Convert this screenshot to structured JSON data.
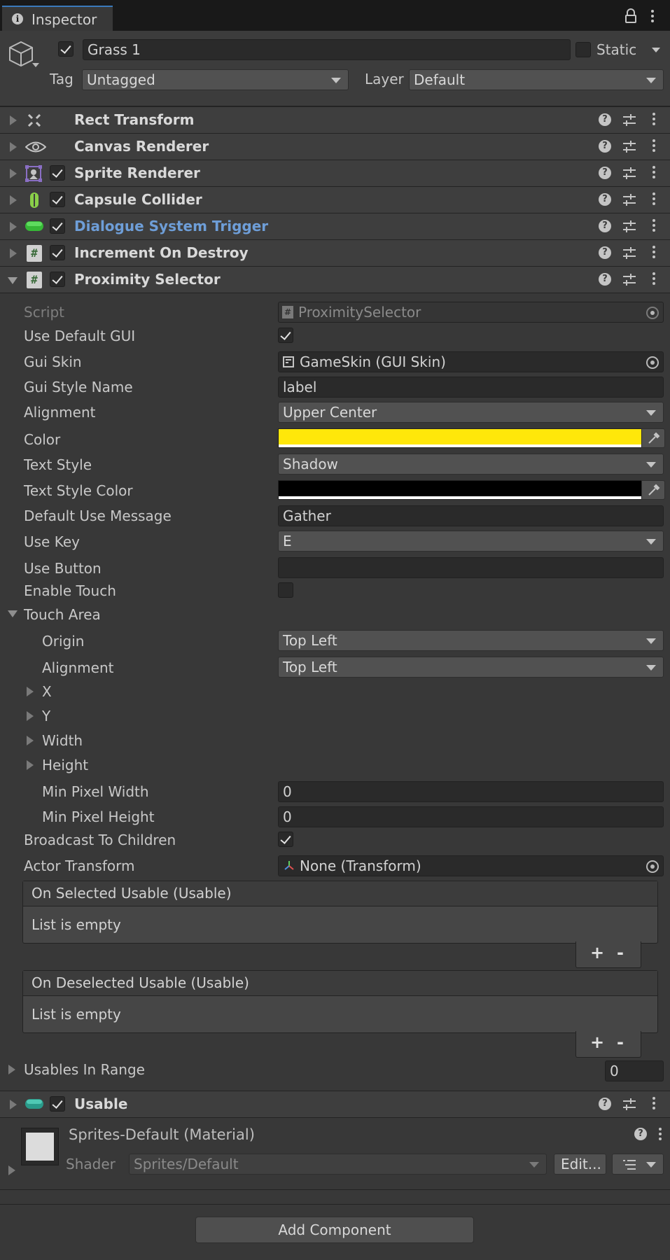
{
  "tab": {
    "title": "Inspector"
  },
  "header": {
    "object_name": "Grass 1",
    "static_label": "Static",
    "tag_label": "Tag",
    "tag_value": "Untagged",
    "layer_label": "Layer",
    "layer_value": "Default"
  },
  "components": [
    {
      "name": "Rect Transform"
    },
    {
      "name": "Canvas Renderer"
    },
    {
      "name": "Sprite Renderer"
    },
    {
      "name": "Capsule Collider"
    },
    {
      "name": "Dialogue System Trigger"
    },
    {
      "name": "Increment On Destroy"
    },
    {
      "name": "Proximity Selector"
    }
  ],
  "proximity": {
    "script_label": "Script",
    "script_value": "ProximitySelector",
    "use_default_gui_label": "Use Default GUI",
    "gui_skin_label": "Gui Skin",
    "gui_skin_value": "GameSkin (GUI Skin)",
    "gui_style_name_label": "Gui Style Name",
    "gui_style_name_value": "label",
    "alignment_label": "Alignment",
    "alignment_value": "Upper Center",
    "color_label": "Color",
    "color_value": "#ffe70a",
    "text_style_label": "Text Style",
    "text_style_value": "Shadow",
    "text_style_color_label": "Text Style Color",
    "text_style_color_value": "#000000",
    "default_use_message_label": "Default Use Message",
    "default_use_message_value": "Gather",
    "use_key_label": "Use Key",
    "use_key_value": "E",
    "use_button_label": "Use Button",
    "use_button_value": "",
    "enable_touch_label": "Enable Touch",
    "touch_area_label": "Touch Area",
    "origin_label": "Origin",
    "origin_value": "Top Left",
    "touch_alignment_label": "Alignment",
    "touch_alignment_value": "Top Left",
    "x_label": "X",
    "y_label": "Y",
    "width_label": "Width",
    "height_label": "Height",
    "min_pixel_width_label": "Min Pixel Width",
    "min_pixel_width_value": "0",
    "min_pixel_height_label": "Min Pixel Height",
    "min_pixel_height_value": "0",
    "broadcast_label": "Broadcast To Children",
    "actor_transform_label": "Actor Transform",
    "actor_transform_value": "None (Transform)",
    "on_selected_title": "On Selected Usable (Usable)",
    "on_deselected_title": "On Deselected Usable (Usable)",
    "list_empty": "List is empty",
    "plus": "+",
    "minus": "-",
    "usables_in_range_label": "Usables In Range",
    "usables_in_range_value": "0"
  },
  "usable": {
    "name": "Usable"
  },
  "material": {
    "name": "Sprites-Default (Material)",
    "shader_label": "Shader",
    "shader_value": "Sprites/Default",
    "edit_label": "Edit..."
  },
  "add_component_label": "Add Component"
}
